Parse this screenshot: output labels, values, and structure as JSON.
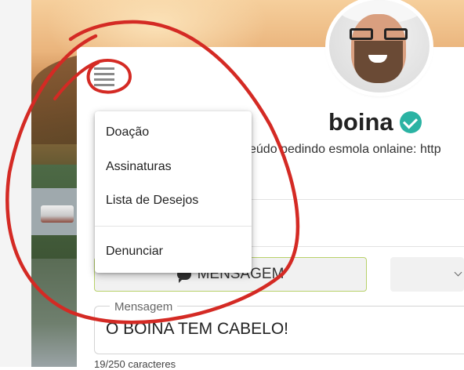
{
  "profile": {
    "name": "boina",
    "bio": "eúdo pedindo esmola onlaine: http",
    "verified_icon": "verified-check-icon",
    "verified_color": "#2bb3a3"
  },
  "menu": {
    "icon": "hamburger-menu-icon",
    "items": [
      "Doação",
      "Assinaturas",
      "Lista de Desejos"
    ],
    "report": "Denunciar"
  },
  "actions": {
    "message_label": "MENSAGEM",
    "message_icon": "chat-bubble-icon",
    "message_border_color": "#b8d16a"
  },
  "message_field": {
    "legend": "Mensagem",
    "value": "O BOINA TEM CABELO!",
    "counter": "19/250 caracteres"
  },
  "annotation": {
    "color": "#d42a24"
  }
}
